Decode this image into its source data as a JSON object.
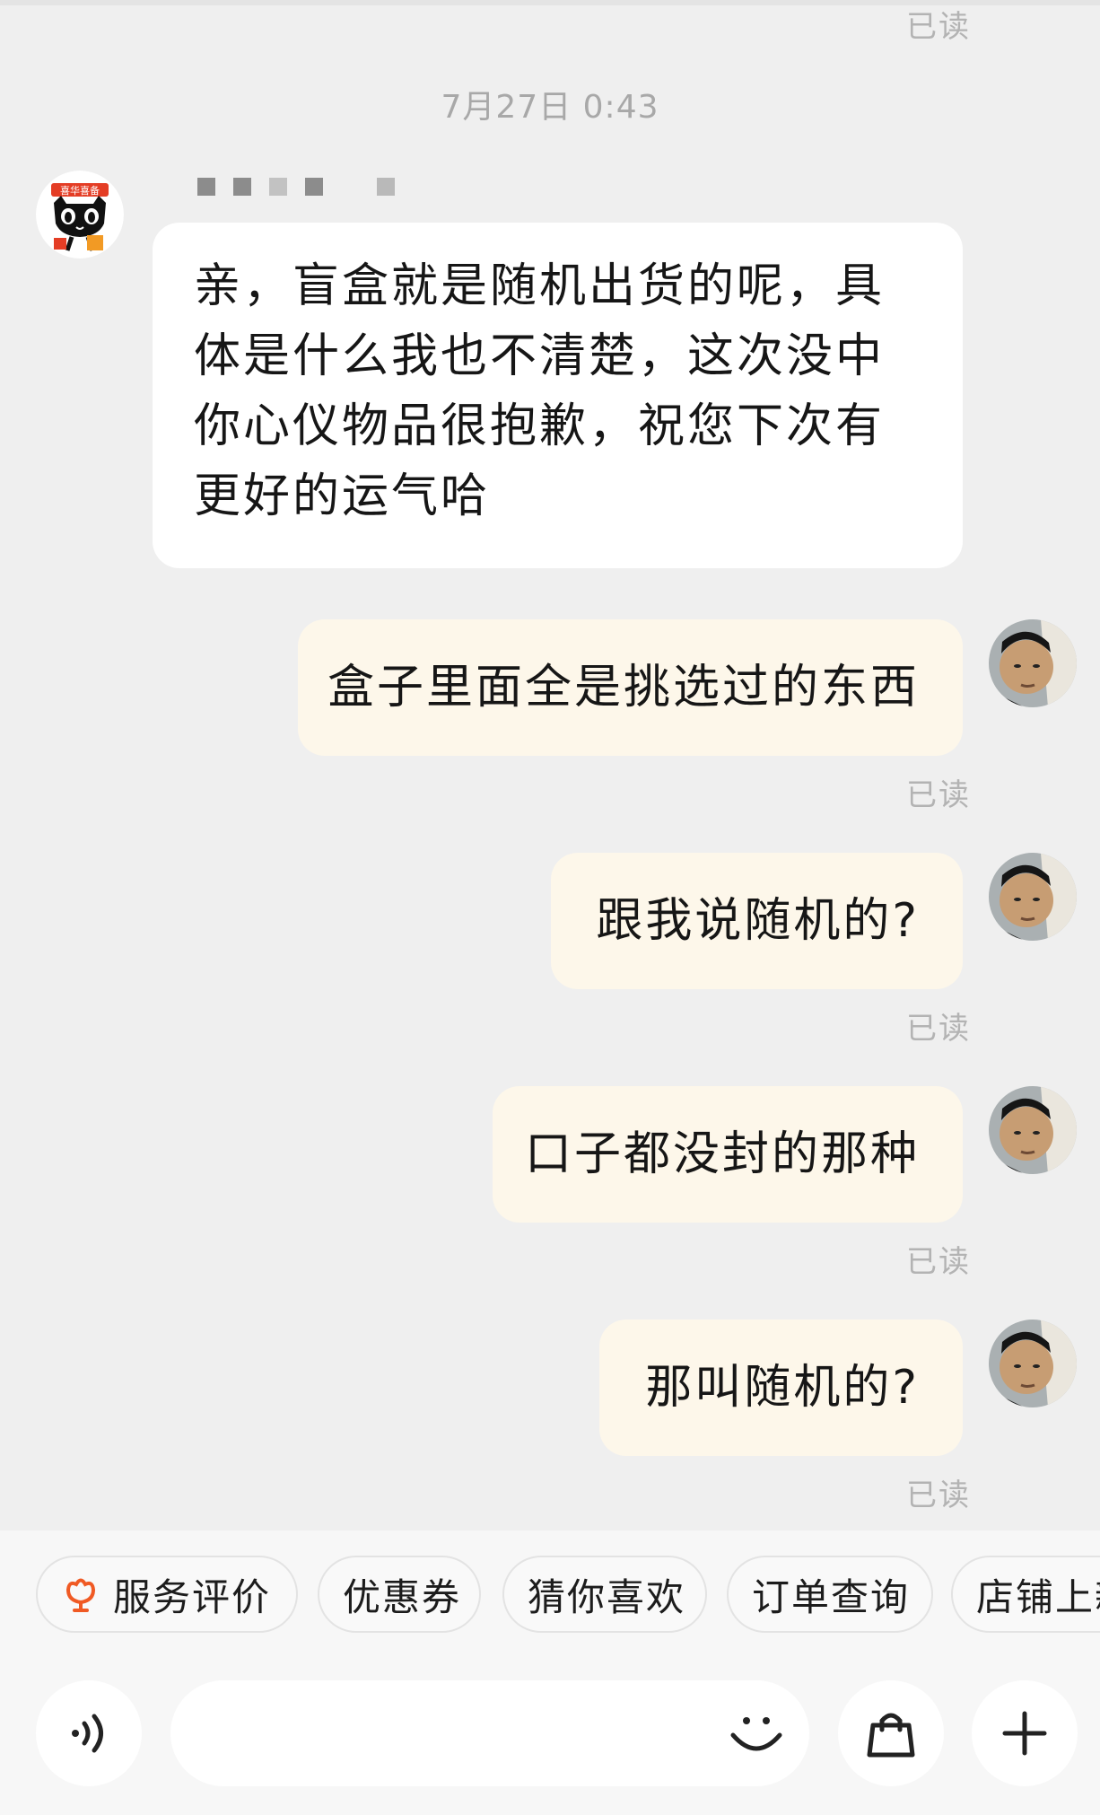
{
  "chat": {
    "read_label": "已读",
    "timestamp": "7月27日 0:43",
    "shop_message": "亲，盲盒就是随机出货的呢，具体是什么我也不清楚，这次没中你心仪物品很抱歉，祝您下次有更好的运气哈",
    "shop_avatar_text": "喜华喜备",
    "messages": [
      {
        "text": "盒子里面全是挑选过的东西",
        "status": "已读"
      },
      {
        "text": "跟我说随机的?",
        "status": "已读"
      },
      {
        "text": "口子都没封的那种",
        "status": "已读"
      },
      {
        "text": "那叫随机的?",
        "status": "已读"
      }
    ]
  },
  "quick_actions": [
    {
      "label": "服务评价",
      "icon": "flower-icon"
    },
    {
      "label": "优惠券"
    },
    {
      "label": "猜你喜欢"
    },
    {
      "label": "订单查询"
    },
    {
      "label": "店铺上新"
    }
  ],
  "input_bar": {
    "voice_icon": "voice-icon",
    "emoji_icon": "smile-icon",
    "bag_icon": "shopping-bag-icon",
    "plus_icon": "plus-icon"
  },
  "colors": {
    "background": "#efefef",
    "incoming_bubble": "#ffffff",
    "outgoing_bubble": "#fdf7ea",
    "read_text": "#b3b3b3",
    "accent": "#f05a24"
  }
}
